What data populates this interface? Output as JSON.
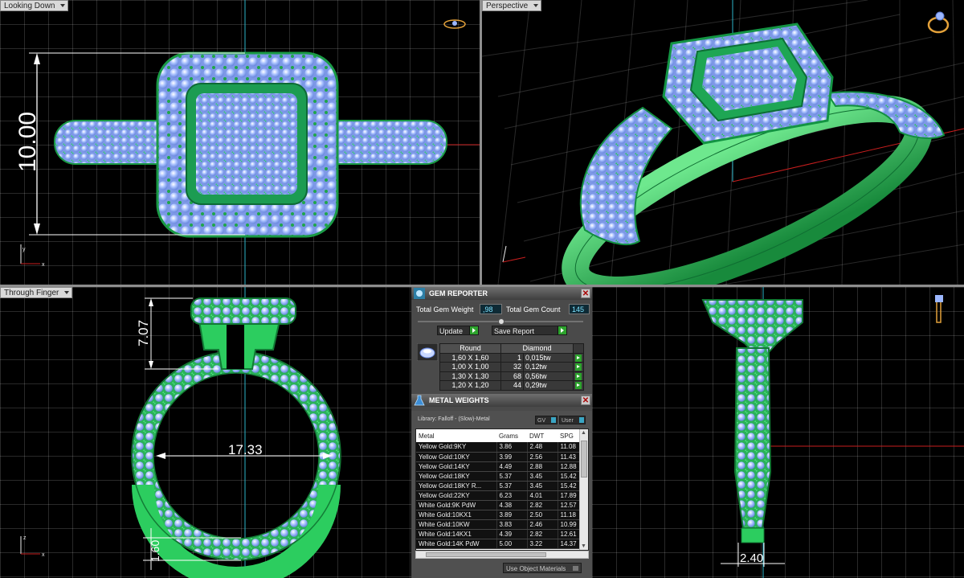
{
  "viewports": {
    "top": {
      "label": "Looking Down",
      "dimension": "10.00"
    },
    "perspective": {
      "label": "Perspective"
    },
    "front": {
      "label": "Through Finger",
      "dim_height": "7.07",
      "dim_width": "17.33",
      "dim_band": "1.60"
    },
    "side": {
      "dim_width": "2.40"
    }
  },
  "gem_reporter": {
    "title": "GEM REPORTER",
    "total_weight_label": "Total Gem Weight",
    "total_weight_value": ",98",
    "total_count_label": "Total Gem Count",
    "total_count_value": "145",
    "update_label": "Update",
    "save_label": "Save Report",
    "table": {
      "col_shape": "Round",
      "col_material": "Diamond",
      "rows": [
        {
          "size": "1,60 X 1,60",
          "count": "1",
          "weight": "0,015tw"
        },
        {
          "size": "1,00 X 1,00",
          "count": "32",
          "weight": "0,12tw"
        },
        {
          "size": "1,30 X 1,30",
          "count": "68",
          "weight": "0,56tw"
        },
        {
          "size": "1,20 X 1,20",
          "count": "44",
          "weight": "0,29tw"
        }
      ]
    }
  },
  "metal_weights": {
    "title": "METAL WEIGHTS",
    "library": "Library: Falloff - (Slow)-Metal",
    "gv_label": "GV",
    "user_label": "User",
    "columns": [
      "Metal",
      "Grams",
      "DWT",
      "SPG"
    ],
    "rows": [
      [
        "Yellow Gold:9KY",
        "3.86",
        "2.48",
        "11.08"
      ],
      [
        "Yellow Gold:10KY",
        "3.99",
        "2.56",
        "11.43"
      ],
      [
        "Yellow Gold:14KY",
        "4.49",
        "2.88",
        "12.88"
      ],
      [
        "Yellow Gold:18KY",
        "5.37",
        "3.45",
        "15.42"
      ],
      [
        "Yellow Gold:18KY R...",
        "5.37",
        "3.45",
        "15.42"
      ],
      [
        "Yellow Gold:22KY",
        "6.23",
        "4.01",
        "17.89"
      ],
      [
        "White Gold:9K PdW",
        "4.38",
        "2.82",
        "12.57"
      ],
      [
        "White Gold:10KX1",
        "3.89",
        "2.50",
        "11.18"
      ],
      [
        "White Gold:10KW",
        "3.83",
        "2.46",
        "10.99"
      ],
      [
        "White Gold:14KX1",
        "4.39",
        "2.82",
        "12.61"
      ],
      [
        "White Gold:14K PdW",
        "5.00",
        "3.22",
        "14.37"
      ]
    ],
    "use_object_label": "Use Object Materials"
  },
  "colors": {
    "metal": "#2fbf5a",
    "gem": "#9fb8ff",
    "dimension_line": "#ffffff",
    "axis_x": "#c81e1e",
    "axis_y": "#2bb5c9"
  }
}
